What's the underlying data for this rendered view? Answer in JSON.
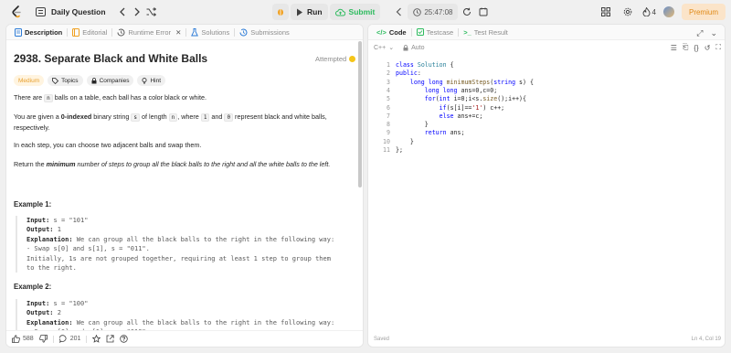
{
  "topbar": {
    "title": "Daily Question",
    "run_label": "Run",
    "submit_label": "Submit",
    "timer": "25:47:08",
    "streak": "4",
    "premium_label": "Premium"
  },
  "left_tabs": [
    {
      "label": "Description"
    },
    {
      "label": "Editorial"
    },
    {
      "label": "Runtime Error"
    },
    {
      "label": "Solutions"
    },
    {
      "label": "Submissions"
    }
  ],
  "problem": {
    "title": "2938. Separate Black and White Balls",
    "status": "Attempted",
    "difficulty": "Medium",
    "chips": [
      "Topics",
      "Companies",
      "Hint"
    ],
    "p1_pre": "There are ",
    "p1_code": "n",
    "p1_post": " balls on a table, each ball has a color black or white.",
    "p2_a": "You are given a ",
    "p2_bold": "0-indexed",
    "p2_b": " binary string ",
    "p2_code1": "s",
    "p2_c": " of length ",
    "p2_code2": "n",
    "p2_d": ", where ",
    "p2_code3": "1",
    "p2_e": " and ",
    "p2_code4": "0",
    "p2_f": " represent black and white balls,",
    "p2_g": "respectively.",
    "p3": "In each step, you can choose two adjacent balls and swap them.",
    "p4_a": "Return the ",
    "p4_bold": "minimum",
    "p4_b": " number of steps to group all the black balls to the right and all the white balls to the left."
  },
  "examples": [
    {
      "title": "Example 1:",
      "input_label": "Input:",
      "input": " s = \"101\"",
      "output_label": "Output:",
      "output": " 1",
      "expl_label": "Explanation:",
      "expl": " We can group all the black balls to the right in the following way:\n- Swap s[0] and s[1], s = \"011\".\nInitially, 1s are not grouped together, requiring at least 1 step to group them\nto the right."
    },
    {
      "title": "Example 2:",
      "input_label": "Input:",
      "input": " s = \"100\"",
      "output_label": "Output:",
      "output": " 2",
      "expl_label": "Explanation:",
      "expl": " We can group all the black balls to the right in the following way:\n- Swap s[0] and s[1], s = \"010\"."
    }
  ],
  "footer": {
    "likes": "588",
    "comments": "201"
  },
  "right_tabs": [
    {
      "label": "Code"
    },
    {
      "label": "Testcase"
    },
    {
      "label": "Test Result"
    }
  ],
  "editor": {
    "language": "C++",
    "mode": "Auto",
    "line_numbers": [
      "1",
      "2",
      "3",
      "4",
      "5",
      "6",
      "7",
      "8",
      "9",
      "10",
      "11"
    ],
    "saved": "Saved",
    "cursor_pos": "Ln 4, Col 19"
  }
}
